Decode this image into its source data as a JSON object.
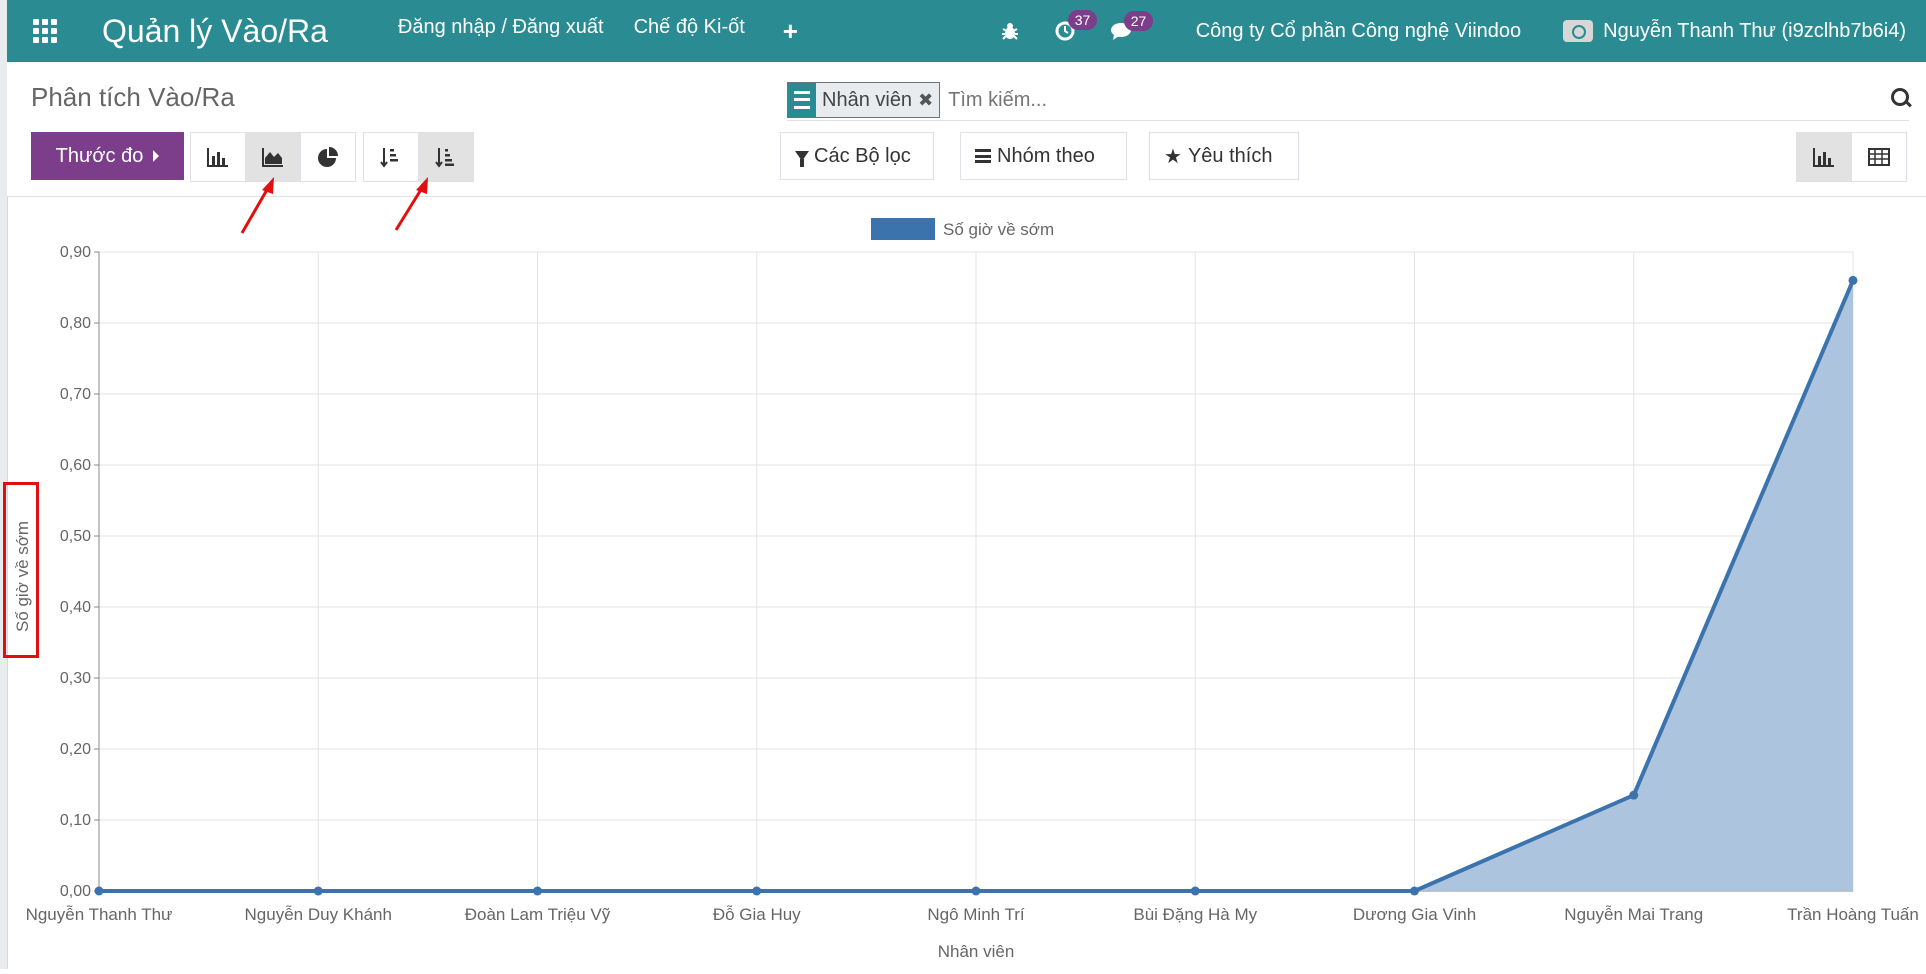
{
  "navbar": {
    "app_title": "Quản lý Vào/Ra",
    "menu": [
      "Đăng nhập / Đăng xuất",
      "Chế độ Ki-ốt"
    ],
    "plus": "+",
    "activity_count": "37",
    "message_count": "27",
    "company": "Công ty Cổ phần Công nghệ Viindoo",
    "user": "Nguyễn Thanh Thư (i9zclhb7b6i4)"
  },
  "control": {
    "breadcrumb": "Phân tích Vào/Ra",
    "facet_label": "Nhân viên",
    "search_placeholder": "Tìm kiếm...",
    "measure_label": "Thước đo",
    "filters_label": "Các Bộ lọc",
    "groupby_label": "Nhóm theo",
    "favorites_label": "Yêu thích",
    "active_chart_type": "area",
    "active_sort": "descending",
    "active_view": "graph"
  },
  "chart_data": {
    "type": "area",
    "categories": [
      "Nguyễn Thanh Thư",
      "Nguyễn Duy Khánh",
      "Đoàn Lam Triệu Vỹ",
      "Đỗ Gia Huy",
      "Ngô Minh Trí",
      "Bùi Đặng Hà My",
      "Dương Gia Vinh",
      "Nguyễn Mai Trang",
      "Trần Hoàng Tuấn"
    ],
    "series": [
      {
        "name": "Số giờ về sớm",
        "values": [
          0,
          0,
          0,
          0,
          0,
          0,
          0,
          0.135,
          0.86
        ],
        "color": "#3b73ad"
      }
    ],
    "xlabel": "Nhân viên",
    "ylabel": "Số giờ về sớm",
    "ylim": [
      0,
      0.9
    ],
    "yticks": [
      "0,00",
      "0,10",
      "0,20",
      "0,30",
      "0,40",
      "0,50",
      "0,60",
      "0,70",
      "0,80",
      "0,90"
    ],
    "grid": true,
    "legend": "top-center",
    "fill_color": "#a9c1dd"
  },
  "annotations": {
    "arrow_color": "#e01010"
  }
}
